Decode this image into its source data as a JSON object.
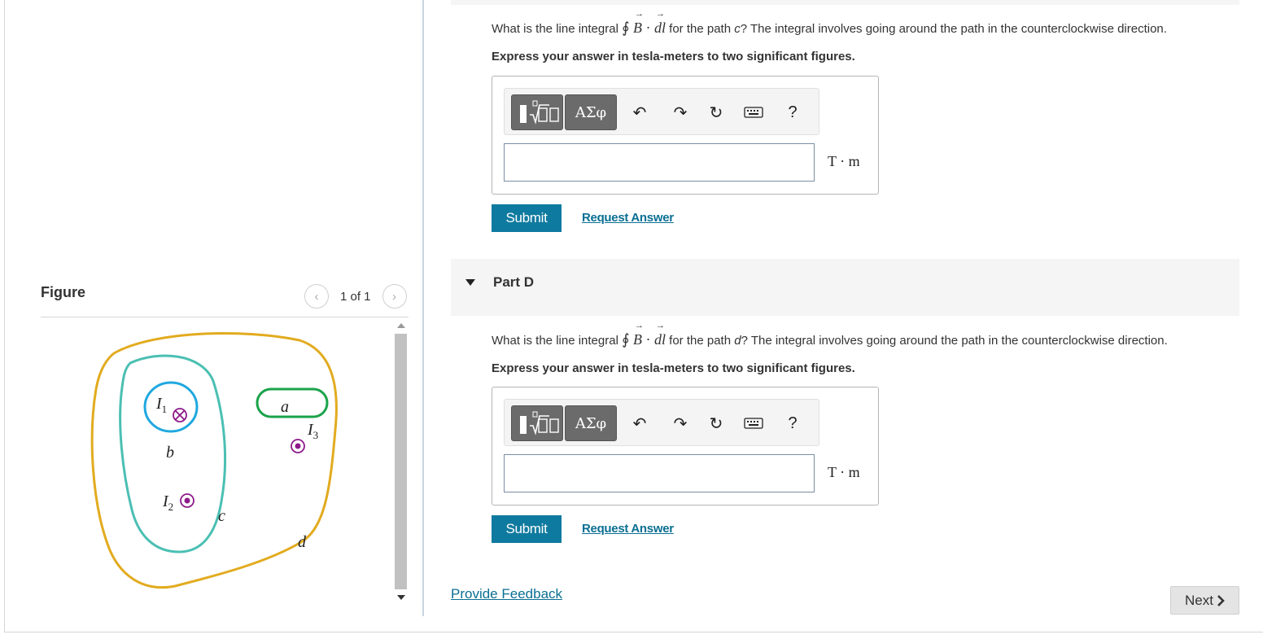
{
  "figure": {
    "title": "Figure",
    "pager_text": "1 of 1",
    "labels": {
      "i1": "I",
      "i1_sub": "1",
      "i2": "I",
      "i2_sub": "2",
      "i3": "I",
      "i3_sub": "3",
      "path_a": "a",
      "path_b": "b",
      "path_c": "c",
      "path_d": "d"
    },
    "colors": {
      "path_a": "#1aa34a",
      "path_b": "#1fa8df",
      "path_c": "#4bbfb3",
      "path_d": "#e2ab1f",
      "current_symbol": "#8e1a8a"
    }
  },
  "part_c": {
    "question_prefix": "What is the line integral",
    "integral_symbol": "∮",
    "b": "B",
    "dot": "·",
    "dl": "dl",
    "question_suffix_1": "for the path",
    "path": "c",
    "question_suffix_2": "? The integral involves going around the path in the counterclockwise direction.",
    "instruction": "Express your answer in tesla-meters to two significant figures.",
    "unit": "T · m",
    "submit_label": "Submit",
    "request_label": "Request Answer"
  },
  "part_d": {
    "title": "Part D",
    "question_prefix": "What is the line integral",
    "integral_symbol": "∮",
    "b": "B",
    "dot": "·",
    "dl": "dl",
    "question_suffix_1": "for the path",
    "path": "d",
    "question_suffix_2": "? The integral involves going around the path in the counterclockwise direction.",
    "instruction": "Express your answer in tesla-meters to two significant figures.",
    "unit": "T · m",
    "submit_label": "Submit",
    "request_label": "Request Answer"
  },
  "toolbar": {
    "greek_label": "ΑΣφ",
    "help_label": "?",
    "icons": [
      "templates-icon",
      "greek-letters-icon",
      "undo-icon",
      "redo-icon",
      "reset-icon",
      "keyboard-icon",
      "help-icon"
    ]
  },
  "footer": {
    "feedback_label": "Provide Feedback",
    "next_label": "Next"
  }
}
